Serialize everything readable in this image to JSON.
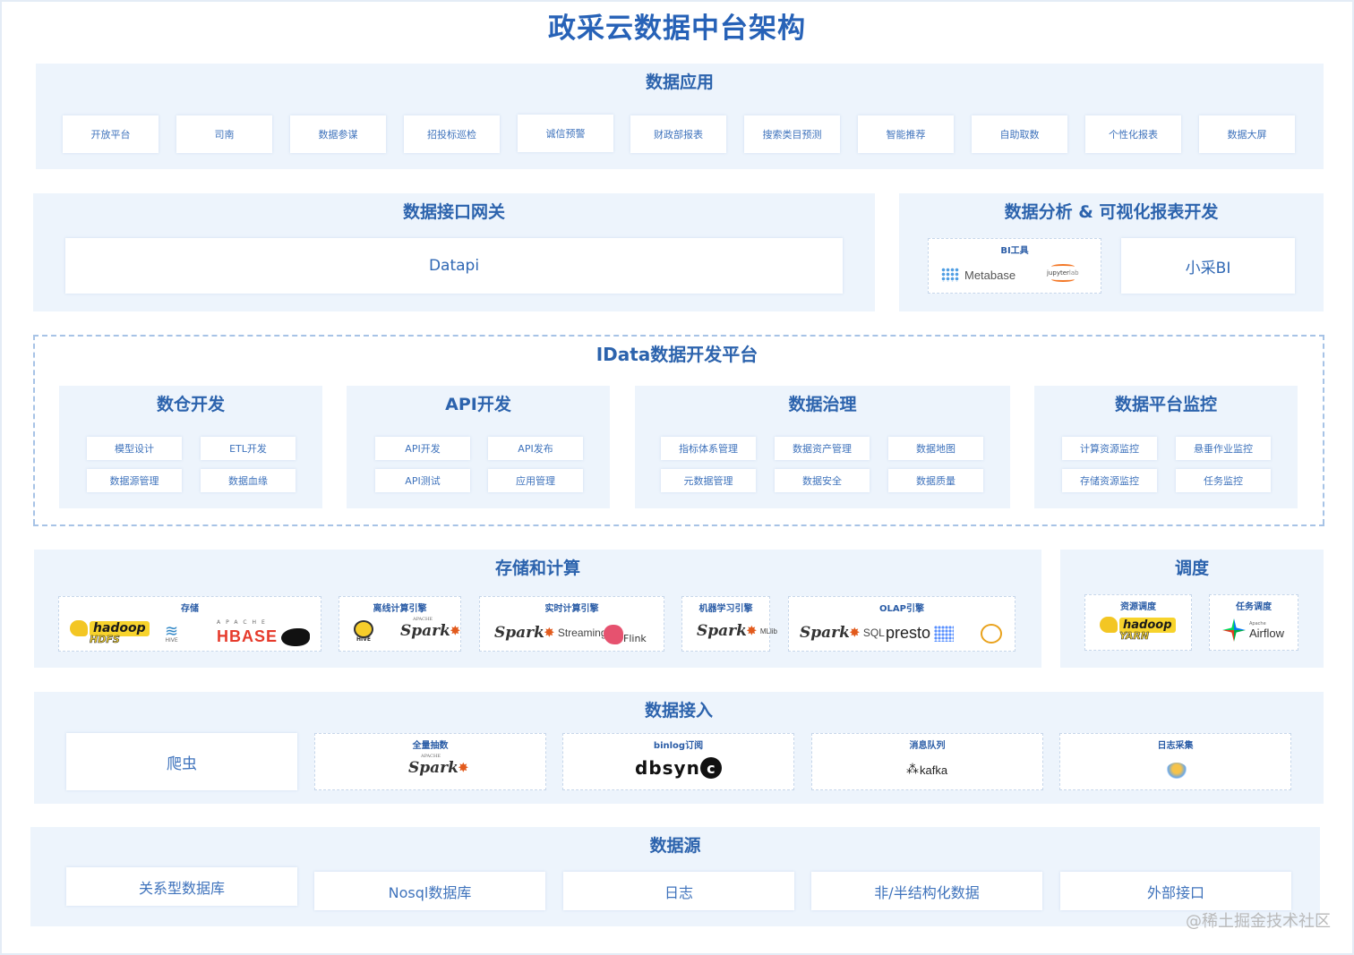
{
  "title": "政采云数据中台架构",
  "app_layer": {
    "title": "数据应用",
    "items": [
      "开放平台",
      "司南",
      "数据参谋",
      "招投标巡检",
      "诚信预警",
      "财政部报表",
      "搜索类目预测",
      "智能推荐",
      "自助取数",
      "个性化报表",
      "数据大屏"
    ]
  },
  "gateway": {
    "title": "数据接口网关",
    "main": "Datapi"
  },
  "analysis": {
    "title": "数据分析 & 可视化报表开发",
    "bi_label": "BI工具",
    "metabase": "Metabase",
    "jupyter": "jupyter",
    "jupyter_lab": "lab",
    "xiaocai": "小采BI"
  },
  "idata": {
    "title": "IData数据开发平台",
    "groups": [
      {
        "title": "数仓开发",
        "items": [
          "模型设计",
          "ETL开发",
          "数据源管理",
          "数据血缘"
        ]
      },
      {
        "title": "API开发",
        "items": [
          "API开发",
          "API发布",
          "API测试",
          "应用管理"
        ]
      },
      {
        "title": "数据治理",
        "items": [
          "指标体系管理",
          "数据资产管理",
          "数据地图",
          "元数据管理",
          "数据安全",
          "数据质量"
        ]
      },
      {
        "title": "数据平台监控",
        "items": [
          "计算资源监控",
          "悬垂作业监控",
          "存储资源监控",
          "任务监控"
        ]
      }
    ]
  },
  "storage": {
    "title": "存储和计算",
    "groups": [
      {
        "label": "存储",
        "hadoop": "hadoop",
        "hdfs": "HDFS",
        "hive": "HIVE",
        "apache": "APACHE",
        "hbase": "HBASE"
      },
      {
        "label": "离线计算引擎",
        "hive": "HIVE",
        "spark": "Spark",
        "apache": "APACHE"
      },
      {
        "label": "实时计算引擎",
        "spark": "Spark",
        "streaming": "Streaming",
        "flink": "Flink"
      },
      {
        "label": "机器学习引擎",
        "spark": "Spark",
        "mllib": "MLlib"
      },
      {
        "label": "OLAP引擎",
        "spark": "Spark",
        "sql": "SQL",
        "presto": "presto"
      }
    ]
  },
  "schedule": {
    "title": "调度",
    "groups": [
      {
        "label": "资源调度",
        "hadoop": "hadoop",
        "yarn": "YARN"
      },
      {
        "label": "任务调度",
        "apache": "Apache",
        "airflow": "Airflow"
      }
    ]
  },
  "ingest": {
    "title": "数据接入",
    "crawler": "爬虫",
    "groups": [
      {
        "label": "全量抽数",
        "spark": "Spark",
        "apache": "APACHE"
      },
      {
        "label": "binlog订阅",
        "dbsync": "dbsyn",
        "dbsync_c": "c"
      },
      {
        "label": "消息队列",
        "kafka": "kafka"
      },
      {
        "label": "日志采集"
      }
    ]
  },
  "sources": {
    "title": "数据源",
    "items": [
      "关系型数据库",
      "Nosql数据库",
      "日志",
      "非/半结构化数据",
      "外部接口"
    ]
  },
  "watermark": "@稀土掘金技术社区",
  "colors": {
    "title": "#2762b7",
    "panel": "#edf4fc",
    "accent": "#1f5fb0",
    "spark_star": "#e25a1c",
    "hbase": "#e63b2c",
    "hadoop": "#f7d32c"
  }
}
